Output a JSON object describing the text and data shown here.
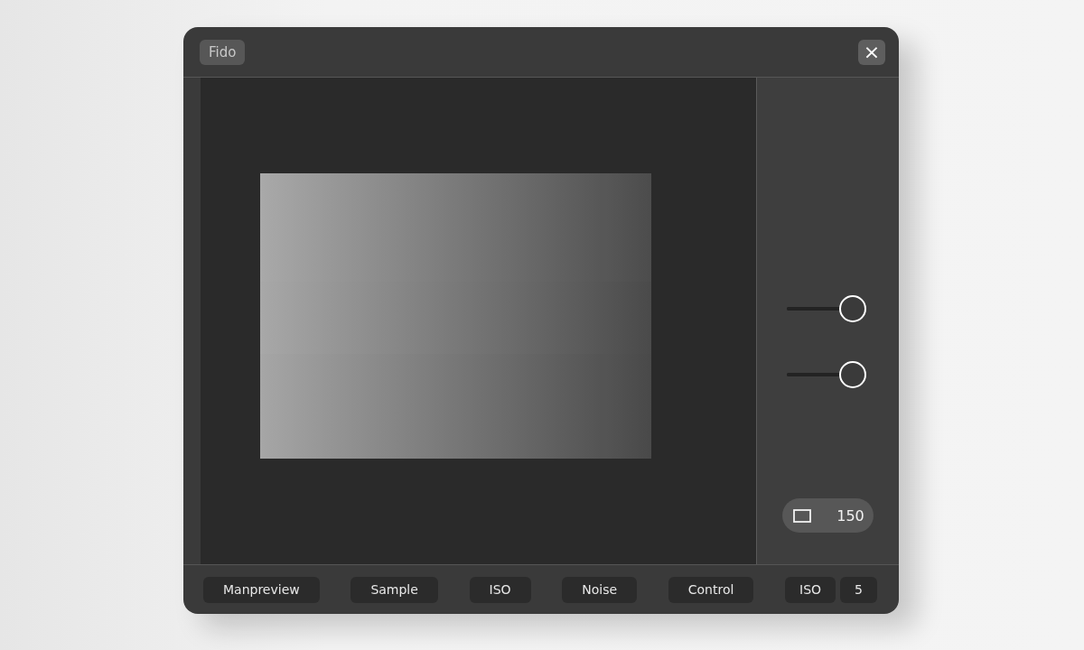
{
  "window": {
    "title": "Fido",
    "close": "×"
  },
  "sliders": [
    {
      "level": 0.84
    },
    {
      "level": 0.84
    }
  ],
  "badge": {
    "value": "150"
  },
  "toolbar": {
    "buttons": [
      "Manpreview",
      "Sample",
      "ISO",
      "Noise",
      "Control"
    ],
    "pair": [
      "ISO",
      "5"
    ]
  }
}
